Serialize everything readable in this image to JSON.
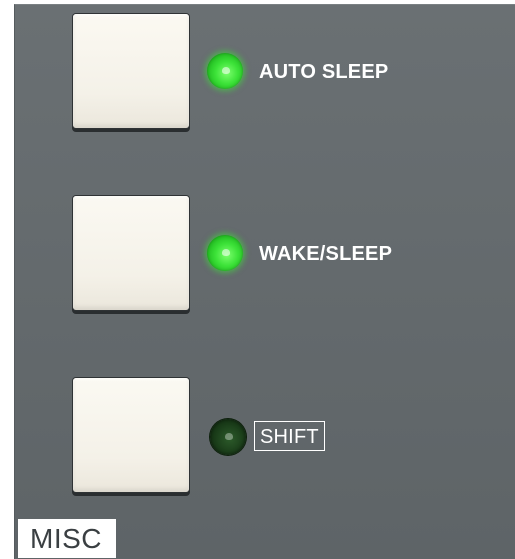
{
  "panel": {
    "section_label": "MISC",
    "controls": [
      {
        "label": "AUTO SLEEP",
        "led": "on",
        "boxed": false
      },
      {
        "label": "WAKE/SLEEP",
        "led": "on",
        "boxed": false
      },
      {
        "label": "SHIFT",
        "led": "off",
        "boxed": true
      }
    ]
  },
  "colors": {
    "panel": "#666c6f",
    "pad": "#f7f5ee",
    "led_on": "#3ce238",
    "led_off": "#1b3e1a",
    "label": "#ffffff"
  }
}
